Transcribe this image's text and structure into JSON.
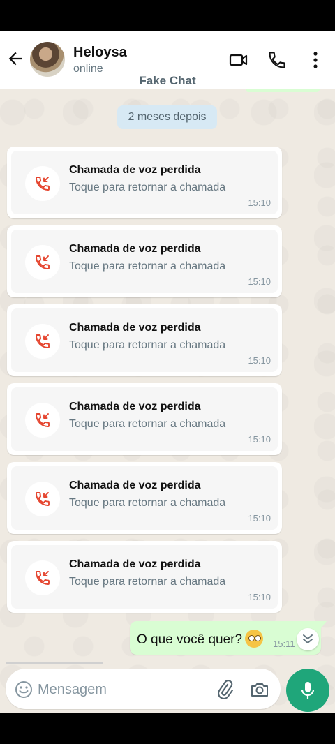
{
  "header": {
    "contact_name": "Heloysa",
    "status": "online",
    "app_label": "Fake Chat"
  },
  "chat": {
    "date_chip": "2 meses depois",
    "missed_calls": [
      {
        "title": "Chamada de voz perdida",
        "subtitle": "Toque para retornar a chamada",
        "time": "15:10"
      },
      {
        "title": "Chamada de voz perdida",
        "subtitle": "Toque para retornar a chamada",
        "time": "15:10"
      },
      {
        "title": "Chamada de voz perdida",
        "subtitle": "Toque para retornar a chamada",
        "time": "15:10"
      },
      {
        "title": "Chamada de voz perdida",
        "subtitle": "Toque para retornar a chamada",
        "time": "15:10"
      },
      {
        "title": "Chamada de voz perdida",
        "subtitle": "Toque para retornar a chamada",
        "time": "15:10"
      },
      {
        "title": "Chamada de voz perdida",
        "subtitle": "Toque para retornar a chamada",
        "time": "15:10"
      }
    ],
    "outgoing_message": {
      "text": "O que você quer?",
      "emoji": "face-with-rolling-eyes",
      "time": "15:11"
    }
  },
  "composer": {
    "placeholder": "Mensagem"
  },
  "colors": {
    "header_bg": "#ffffff",
    "chat_bg": "#efeae2",
    "outgoing_bubble": "#d9fdd3",
    "date_chip": "#d7e9f4",
    "missed_call_red": "#e5452f",
    "mic_button": "#1fa67a"
  }
}
